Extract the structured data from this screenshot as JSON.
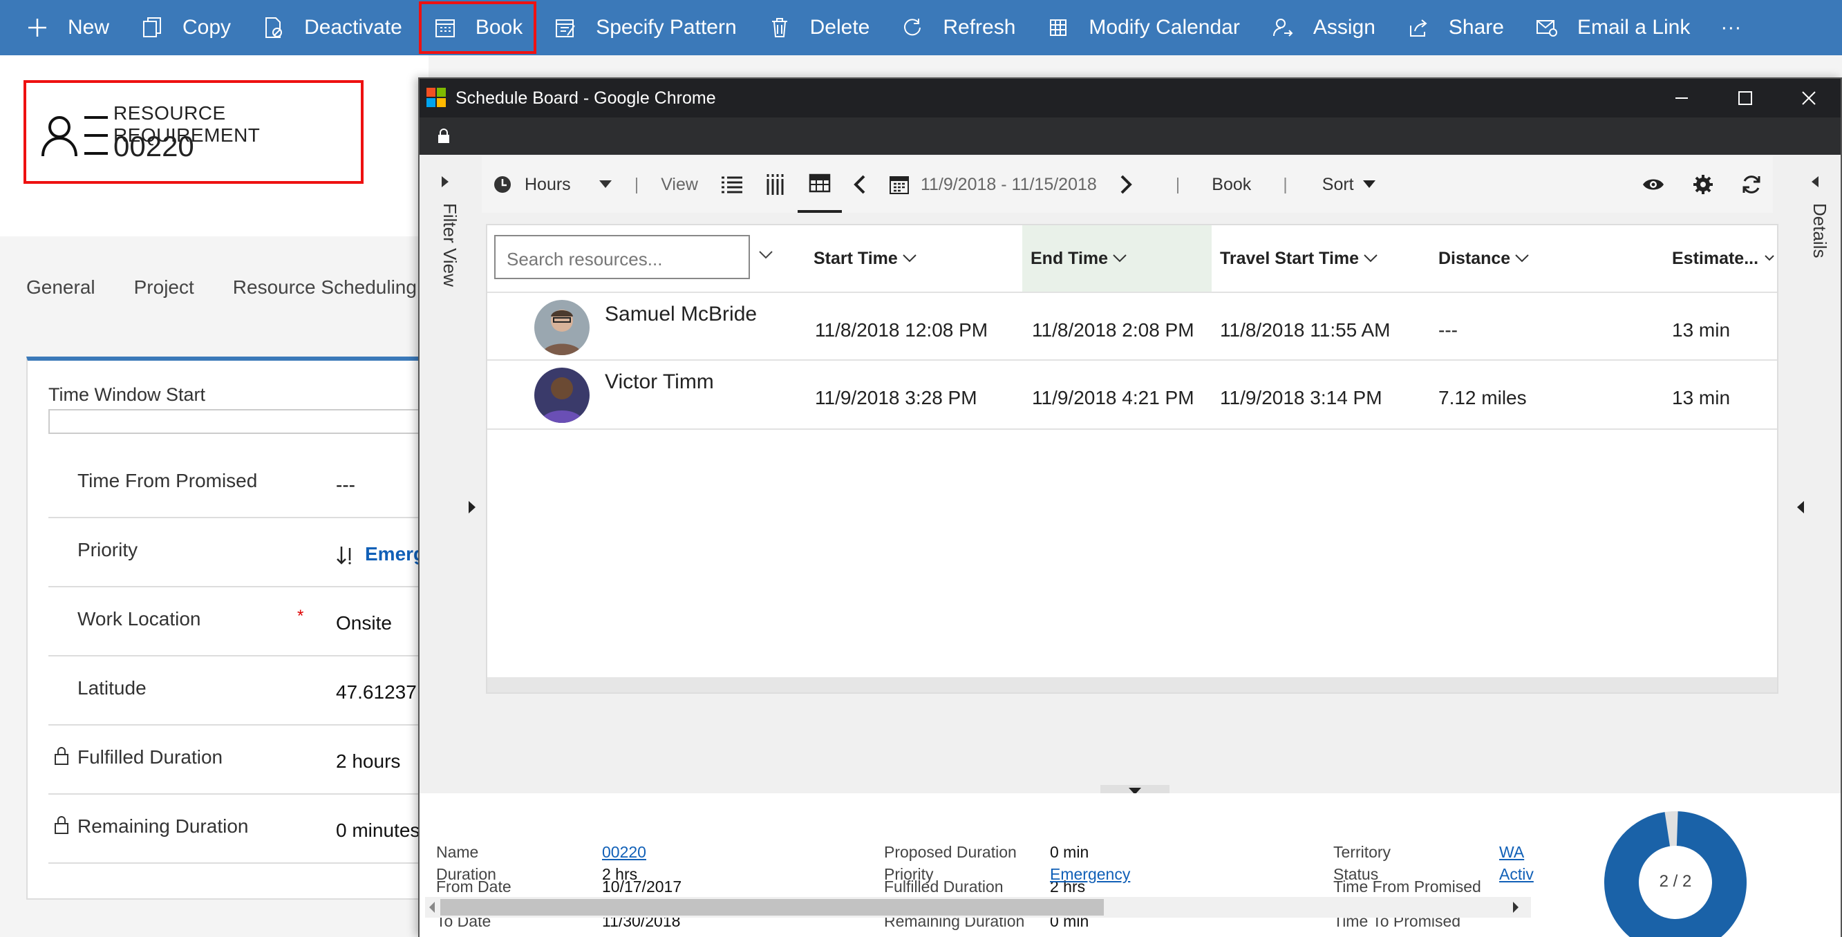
{
  "command_bar": {
    "items": [
      {
        "label": "New",
        "icon": "plus-icon"
      },
      {
        "label": "Copy",
        "icon": "copy-icon"
      },
      {
        "label": "Deactivate",
        "icon": "deactivate-icon"
      },
      {
        "label": "Book",
        "icon": "calendar-icon"
      },
      {
        "label": "Specify Pattern",
        "icon": "pattern-icon"
      },
      {
        "label": "Delete",
        "icon": "trash-icon"
      },
      {
        "label": "Refresh",
        "icon": "refresh-icon"
      },
      {
        "label": "Modify Calendar",
        "icon": "grid-icon"
      },
      {
        "label": "Assign",
        "icon": "assign-icon"
      },
      {
        "label": "Share",
        "icon": "share-icon"
      },
      {
        "label": "Email a Link",
        "icon": "email-icon"
      }
    ],
    "more": "···"
  },
  "header": {
    "entity": "RESOURCE REQUIREMENT",
    "number": "00220"
  },
  "tabs": [
    "General",
    "Project",
    "Resource Scheduling C"
  ],
  "form": {
    "time_window_start_label": "Time Window Start",
    "rows": [
      {
        "label": "Time From Promised",
        "value": "---"
      },
      {
        "label": "Priority",
        "value": "Emergen"
      },
      {
        "label": "Work Location",
        "value": "Onsite",
        "required": "*"
      },
      {
        "label": "Latitude",
        "value": "47.61237"
      },
      {
        "label": "Fulfilled Duration",
        "value": "2 hours"
      },
      {
        "label": "Remaining Duration",
        "value": "0 minutes"
      }
    ]
  },
  "window": {
    "title": "Schedule Board - Google Chrome",
    "filter_label": "Filter View",
    "details_label": "Details"
  },
  "toolbar": {
    "hours": "Hours",
    "view": "View",
    "date_range": "11/9/2018 - 11/15/2018",
    "book": "Book",
    "sort": "Sort"
  },
  "grid": {
    "search_placeholder": "Search resources...",
    "columns": [
      "Start Time",
      "End Time",
      "Travel Start Time",
      "Distance",
      "Estimate..."
    ],
    "rows": [
      {
        "name": "Samuel McBride",
        "start": "11/8/2018 12:08 PM",
        "end": "11/8/2018 2:08 PM",
        "travel": "11/8/2018 11:55 AM",
        "distance": "---",
        "estimate": "13 min"
      },
      {
        "name": "Victor Timm",
        "start": "11/9/2018 3:28 PM",
        "end": "11/9/2018 4:21 PM",
        "travel": "11/9/2018 3:14 PM",
        "distance": "7.12 miles",
        "estimate": "13 min"
      }
    ]
  },
  "details": {
    "col1": [
      {
        "label": "Name",
        "value": "00220"
      },
      {
        "label": "From Date",
        "value": "10/17/2017"
      },
      {
        "label": "To Date",
        "value": "11/30/2018"
      },
      {
        "label": "Duration",
        "value": "2 hrs"
      }
    ],
    "col2": [
      {
        "label": "Proposed Duration",
        "value": "0 min"
      },
      {
        "label": "Fulfilled Duration",
        "value": "2 hrs"
      },
      {
        "label": "Remaining Duration",
        "value": "0 min"
      },
      {
        "label": "Priority",
        "value": "Emergency"
      }
    ],
    "col3": [
      {
        "label": "Territory",
        "value": "WA"
      },
      {
        "label": "Time From Promised",
        "value": ""
      },
      {
        "label": "Time To Promised",
        "value": ""
      },
      {
        "label": "Status",
        "value": "Activ"
      }
    ],
    "donut_label": "2 / 2",
    "donut_fraction": 0.97
  },
  "colors": {
    "command_bar": "#3b79b9",
    "highlight": "#ee1111",
    "link": "#1160b7",
    "donut": "#1a62a8"
  }
}
